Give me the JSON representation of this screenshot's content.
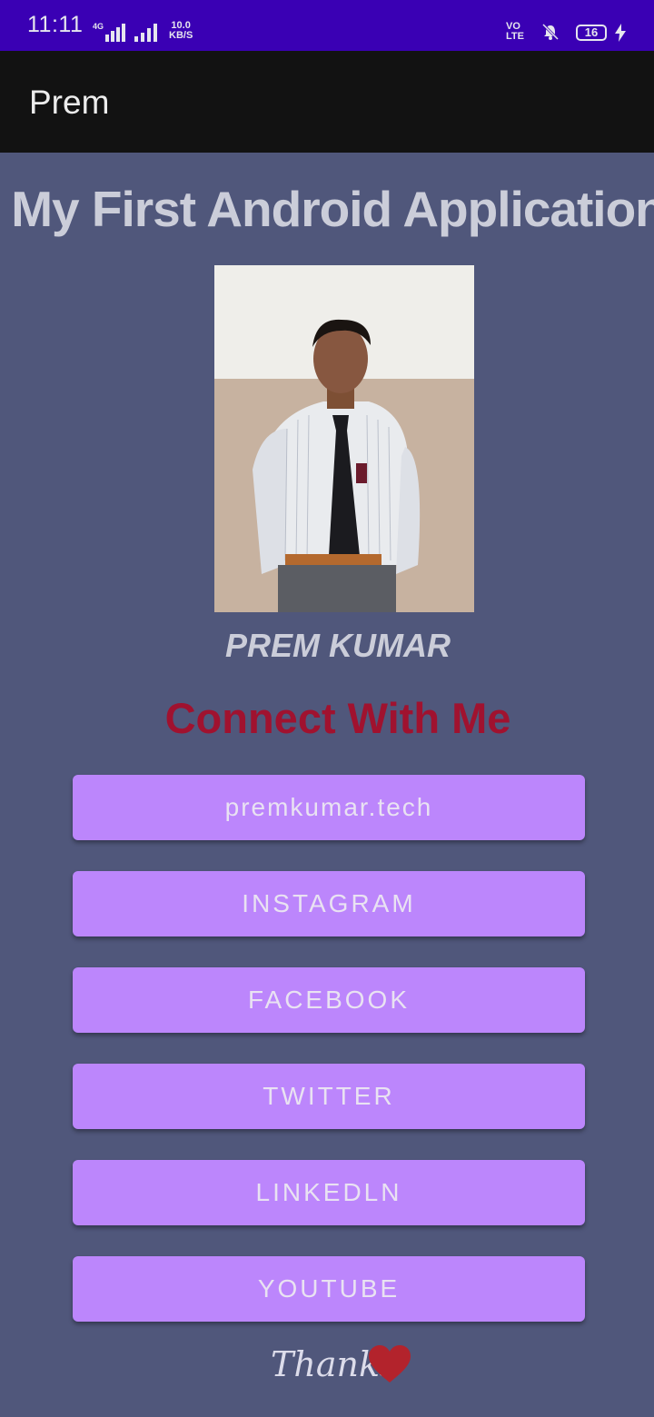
{
  "status_bar": {
    "time": "11:11",
    "network_type": "4G",
    "speed_value": "10.0",
    "speed_unit": "KB/S",
    "volte": "VO",
    "volte_sub": "LTE",
    "battery": "16"
  },
  "app_bar": {
    "title": "Prem"
  },
  "main": {
    "heading": "My First Android Application",
    "name": "PREM KUMAR",
    "connect_title": "Connect With Me",
    "buttons": [
      {
        "label": "premkumar.tech"
      },
      {
        "label": "INSTAGRAM"
      },
      {
        "label": "FACEBOOK"
      },
      {
        "label": "TWITTER"
      },
      {
        "label": "LINKEDLN"
      },
      {
        "label": "YOUTUBE"
      }
    ],
    "thanks": "Thanks"
  },
  "colors": {
    "status_bar": "#3a00b4",
    "app_bar": "#121212",
    "background": "#50577b",
    "button": "#bc86fc",
    "connect_title": "#a0122f"
  },
  "icons": [
    "signal-icon",
    "mute-vibrate-icon",
    "battery-icon",
    "charging-icon",
    "heart-icon"
  ]
}
